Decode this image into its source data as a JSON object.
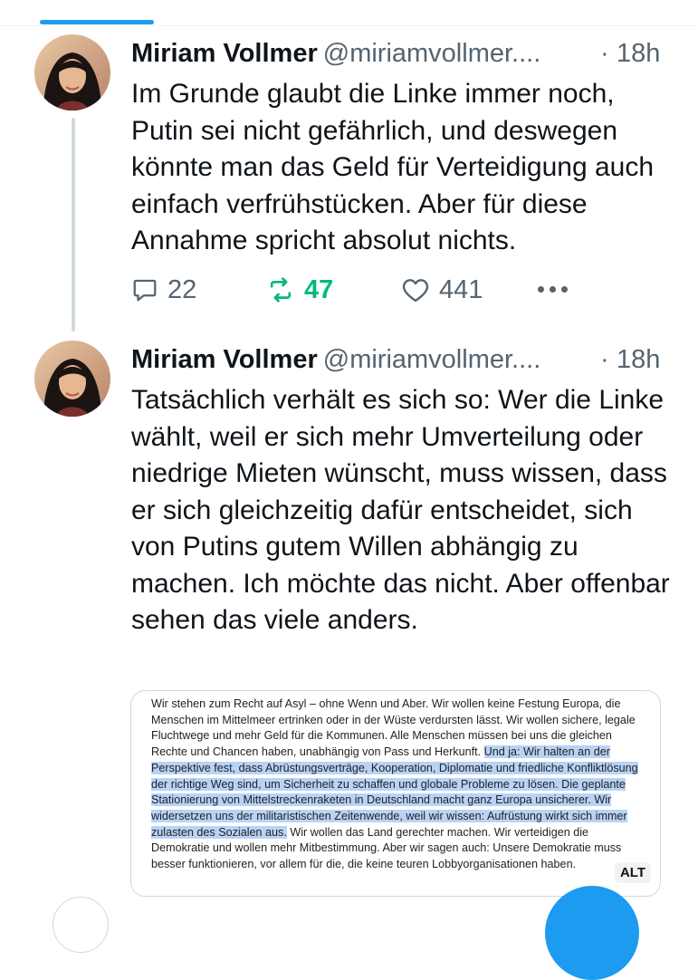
{
  "colors": {
    "accent": "#1d9bf0",
    "retweet_active": "#00ba7c",
    "text_primary": "#0f1419",
    "text_secondary": "#536471",
    "highlight": "#b8d3f7"
  },
  "tweets": [
    {
      "author_name": "Miriam Vollmer",
      "author_handle": "@miriamvollmer....",
      "separator": "·",
      "time": "18h",
      "text": "Im Grunde glaubt die Linke immer noch, Putin sei nicht gefährlich, und deswegen könnte man das Geld für Verteidigung auch einfach verfrühstücken. Aber für diese Annahme spricht absolut nichts.",
      "replies": "22",
      "retweets": "47",
      "likes": "441",
      "icons": [
        "reply-icon",
        "retweet-icon",
        "like-icon",
        "more-icon"
      ]
    },
    {
      "author_name": "Miriam Vollmer",
      "author_handle": "@miriamvollmer....",
      "separator": "·",
      "time": "18h",
      "text": "Tatsächlich verhält es sich so: Wer die Linke wählt, weil er sich mehr Umverteilung oder niedrige Mieten wünscht, muss wissen, dass er sich gleichzeitig dafür entscheidet, sich von Putins gutem Willen abhängig zu machen. Ich möchte das nicht. Aber offenbar sehen das viele anders.",
      "media": {
        "text_before": "Wir stehen zum Recht auf Asyl – ohne Wenn und Aber. Wir wollen keine Festung Europa, die Menschen im Mittelmeer ertrinken oder in der Wüste verdursten lässt. Wir wollen sichere, legale Fluchtwege und mehr Geld für die Kommunen. Alle Menschen müssen bei uns die gleichen Rechte und Chancen haben, unabhängig von Pass und Herkunft. ",
        "text_highlight": "Und ja: Wir halten an der Perspektive fest, dass Abrüstungsverträge, Kooperation, Diplomatie und friedliche Konfliktlösung der richtige Weg sind, um Sicherheit zu schaffen und globale Probleme zu lösen. Die geplante Stationierung von Mittelstreckenraketen in Deutschland macht ganz Europa unsicherer. Wir widersetzen uns der militaristischen Zeitenwende, weil wir wissen: Aufrüstung wirkt sich immer zulasten des Sozialen aus.",
        "text_after": " Wir wollen das Land gerechter machen. Wir verteidigen die Demokratie und wollen mehr Mitbestimmung. Aber wir sagen auch: Unsere Demokratie muss besser funktionieren, vor allem für die, die keine teuren Lobbyorganisationen haben.",
        "alt_label": "ALT"
      }
    }
  ]
}
